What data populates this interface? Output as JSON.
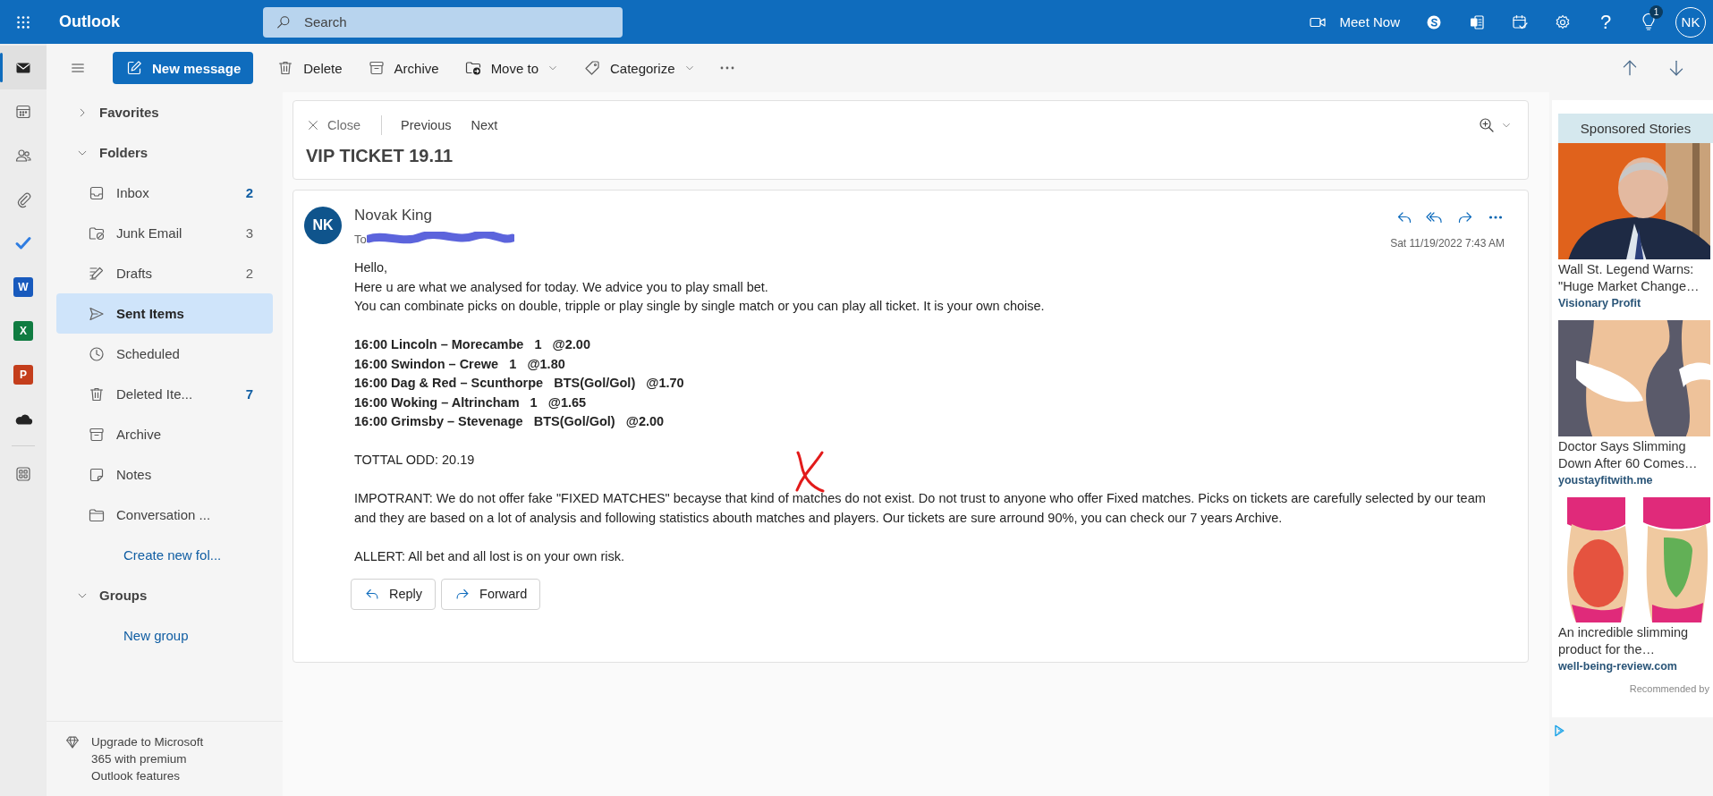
{
  "app": {
    "name": "Outlook",
    "search_placeholder": "Search",
    "meet_now": "Meet Now",
    "help": "?",
    "notification_count": "1",
    "avatar": "NK"
  },
  "rail": [
    {
      "kind": "mail",
      "selected": true
    },
    {
      "kind": "calendar",
      "selected": false
    },
    {
      "kind": "people",
      "selected": false
    },
    {
      "kind": "attach",
      "selected": false
    },
    {
      "kind": "todo",
      "selected": false
    },
    {
      "kind": "word",
      "letter": "W",
      "selected": false
    },
    {
      "kind": "excel",
      "letter": "X",
      "selected": false
    },
    {
      "kind": "powerpoint",
      "letter": "P",
      "selected": false
    },
    {
      "kind": "onedrive",
      "selected": false
    },
    {
      "kind": "apps",
      "selected": false
    }
  ],
  "commands": [
    {
      "kind": "compose",
      "label": "New message",
      "dropdown": false
    },
    {
      "kind": "delete",
      "label": "Delete",
      "dropdown": false
    },
    {
      "kind": "archive",
      "label": "Archive",
      "dropdown": false
    },
    {
      "kind": "move",
      "label": "Move to",
      "dropdown": true
    },
    {
      "kind": "categorize",
      "label": "Categorize",
      "dropdown": true
    },
    {
      "kind": "more",
      "dropdown": false
    }
  ],
  "folders": {
    "sections": [
      {
        "label": "Favorites",
        "expanded": false
      },
      {
        "label": "Folders",
        "expanded": true,
        "items": [
          {
            "kind": "folder",
            "label": "Inbox",
            "count": "2",
            "unread": true,
            "selected": false
          },
          {
            "kind": "folder",
            "label": "Junk Email",
            "count": "3",
            "unread": false,
            "selected": false
          },
          {
            "kind": "folder",
            "label": "Drafts",
            "count": "2",
            "unread": false,
            "selected": false
          },
          {
            "kind": "folder",
            "label": "Sent Items",
            "selected": true
          },
          {
            "kind": "folder",
            "label": "Scheduled",
            "selected": false
          },
          {
            "kind": "folder",
            "label": "Deleted Ite...",
            "count": "7",
            "unread": true,
            "selected": false
          },
          {
            "kind": "folder",
            "label": "Archive",
            "selected": false
          },
          {
            "kind": "folder",
            "label": "Notes",
            "selected": false
          },
          {
            "kind": "folder",
            "label": "Conversation ...",
            "selected": false
          },
          {
            "kind": "link",
            "label": "Create new fol...",
            "selected": false
          }
        ]
      },
      {
        "label": "Groups",
        "expanded": true,
        "items": [
          {
            "kind": "link",
            "label": "New group",
            "selected": false
          }
        ]
      }
    ],
    "upgrade": "Upgrade to Microsoft 365 with premium Outlook features"
  },
  "reading": {
    "close": "Close",
    "previous": "Previous",
    "next": "Next",
    "subject": "VIP TICKET 19.11",
    "message": {
      "avatar": "NK",
      "sender": "Novak King",
      "to_label": "To",
      "date": "Sat 11/19/2022 7:43 AM",
      "paragraphs": [
        {
          "kind": "plain",
          "lines": [
            "Hello,",
            "Here u are what we analysed for today. We advice you to play small bet.",
            "You can combinate picks on double, tripple or play single by single match or you can play all ticket. It is your own choise."
          ]
        },
        {
          "kind": "bold",
          "lines": [
            "16:00 Lincoln – Morecambe   1   @2.00",
            "16:00 Swindon – Crewe   1   @1.80",
            "16:00 Dag & Red – Scunthorpe   BTS(Gol/Gol)   @1.70",
            "16:00 Woking – Altrincham   1   @1.65",
            "16:00 Grimsby – Stevenage   BTS(Gol/Gol)   @2.00"
          ]
        },
        {
          "kind": "plain",
          "lines": [
            "TOTTAL ODD: 20.19"
          ]
        },
        {
          "kind": "plain",
          "lines": [
            "IMPOTRANT: We do not offer fake \"FIXED MATCHES\" becayse that kind of matches do not exist. Do not trust to anyone who offer Fixed matches. Picks on tickets are carefully selected by our team and they are based on a lot of analysis and following statistics abouth matches and players. Our tickets are sure arround 90%, you can check our 7 years Archive."
          ]
        },
        {
          "kind": "plain",
          "lines": [
            "ALLERT: All bet and all lost is on your own risk."
          ]
        }
      ],
      "buttons": [
        {
          "kind": "reply",
          "label": "Reply"
        },
        {
          "kind": "forward",
          "label": "Forward"
        }
      ]
    }
  },
  "ads": {
    "title": "Sponsored Stories",
    "items": [
      {
        "kind": "picture",
        "headline": "Wall St. Legend Warns: \"Huge Market Change…",
        "source": "Visionary Profit"
      },
      {
        "kind": "picture",
        "headline": "Doctor Says Slimming Down After 60 Comes…",
        "source": "youstayfitwith.me"
      },
      {
        "kind": "picture",
        "headline": "An incredible slimming product for the…",
        "source": "well-being-review.com"
      }
    ],
    "footer": "Recommended by"
  }
}
